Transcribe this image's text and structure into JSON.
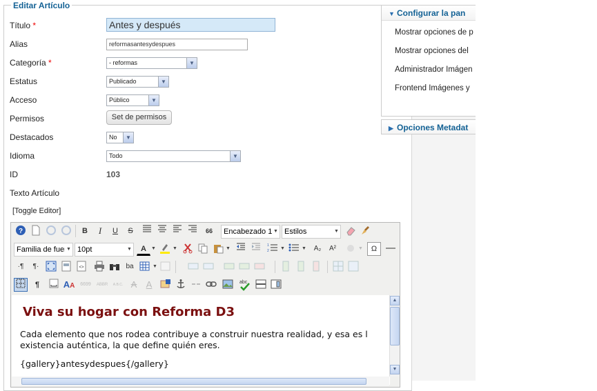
{
  "form": {
    "legend": "Editar Artículo",
    "labels": {
      "titulo": "Título",
      "alias": "Alias",
      "categoria": "Categoría",
      "estatus": "Estatus",
      "acceso": "Acceso",
      "permisos": "Permisos",
      "destacados": "Destacados",
      "idioma": "Idioma",
      "id": "ID",
      "texto": "Texto Artículo"
    },
    "required_mark": "*",
    "title_value": "Antes y después",
    "alias_value": "reformasantesydespues",
    "categoria_value": "- reformas",
    "estatus_value": "Publicado",
    "acceso_value": "Público",
    "permisos_button": "Set de permisos",
    "destacados_value": "No",
    "idioma_value": "Todo",
    "id_value": "103",
    "toggle_editor": "[Toggle Editor]"
  },
  "editor": {
    "format_select": "Encabezado 1",
    "styles_select": "Estilos",
    "font_family_select": "Familia de fuen",
    "font_size_select": "10pt",
    "heading_text": "Viva su hogar con Reforma D3",
    "paragraph_line1": "Cada elemento que nos rodea contribuye a construir nuestra realidad, y esa es l",
    "paragraph_line2": "existencia auténtica, la que define quién eres.",
    "gallery_text": "{gallery}antesydespues{/gallery}",
    "icons": {
      "bold": "B",
      "italic": "I",
      "underline": "U",
      "strike": "S",
      "quote": "66",
      "abbr": "ABBR",
      "acronym": "A.B.C.",
      "subscript": "A₂",
      "superscript": "A²",
      "omega": "Ω",
      "pilcrow": "¶",
      "text_a": "A",
      "abc": "abc",
      "quote_glyph": "6699",
      "ba": "ba"
    }
  },
  "right_panel": {
    "config_title": "Configurar la pan",
    "items": [
      "Mostrar opciones de p",
      "Mostrar opciones del",
      "Administrador Imágen",
      "Frontend Imágenes y"
    ],
    "metadata_title": "Opciones Metadat"
  },
  "colors": {
    "legend": "#146295",
    "heading": "#7b1010",
    "title_input_bg": "#d5e9f8",
    "required": "#ee0000"
  }
}
